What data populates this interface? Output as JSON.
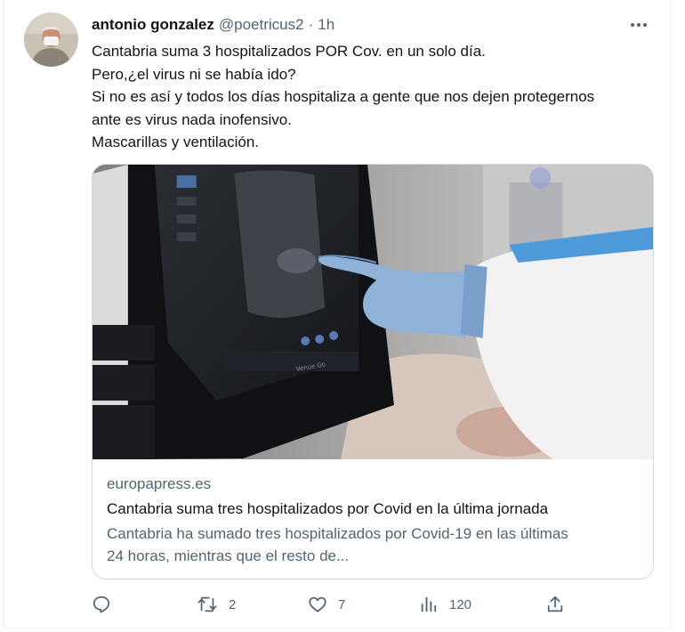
{
  "tweet": {
    "author_name": "antonio gonzalez",
    "author_handle": "@poetricus2",
    "separator": "·",
    "timestamp": "1h",
    "text_lines": [
      "Cantabria suma 3 hospitalizados POR Cov. en un solo día.",
      "Pero,¿el virus ni se había ido?",
      "Si no es así y todos los días hospitaliza a gente que nos dejen protegernos",
      "ante es virus nada inofensivo.",
      "Mascarillas y ventilación."
    ]
  },
  "card": {
    "domain": "europapress.es",
    "title": "Cantabria suma tres hospitalizados por Covid en la última jornada",
    "description_lines": [
      "Cantabria ha sumado tres hospitalizados por Covid-19 en las últimas",
      "24 horas, mientras que el resto de..."
    ],
    "screen_label": "Venue Go"
  },
  "actions": {
    "reply_count": "",
    "retweet_count": "2",
    "like_count": "7",
    "views_count": "120"
  },
  "colors": {
    "text_primary": "#0f1419",
    "text_secondary": "#536471",
    "border": "#cfd9de",
    "glove": "#8fb2d9"
  },
  "icons": [
    "more-icon",
    "reply-icon",
    "retweet-icon",
    "like-icon",
    "views-icon",
    "share-icon"
  ]
}
